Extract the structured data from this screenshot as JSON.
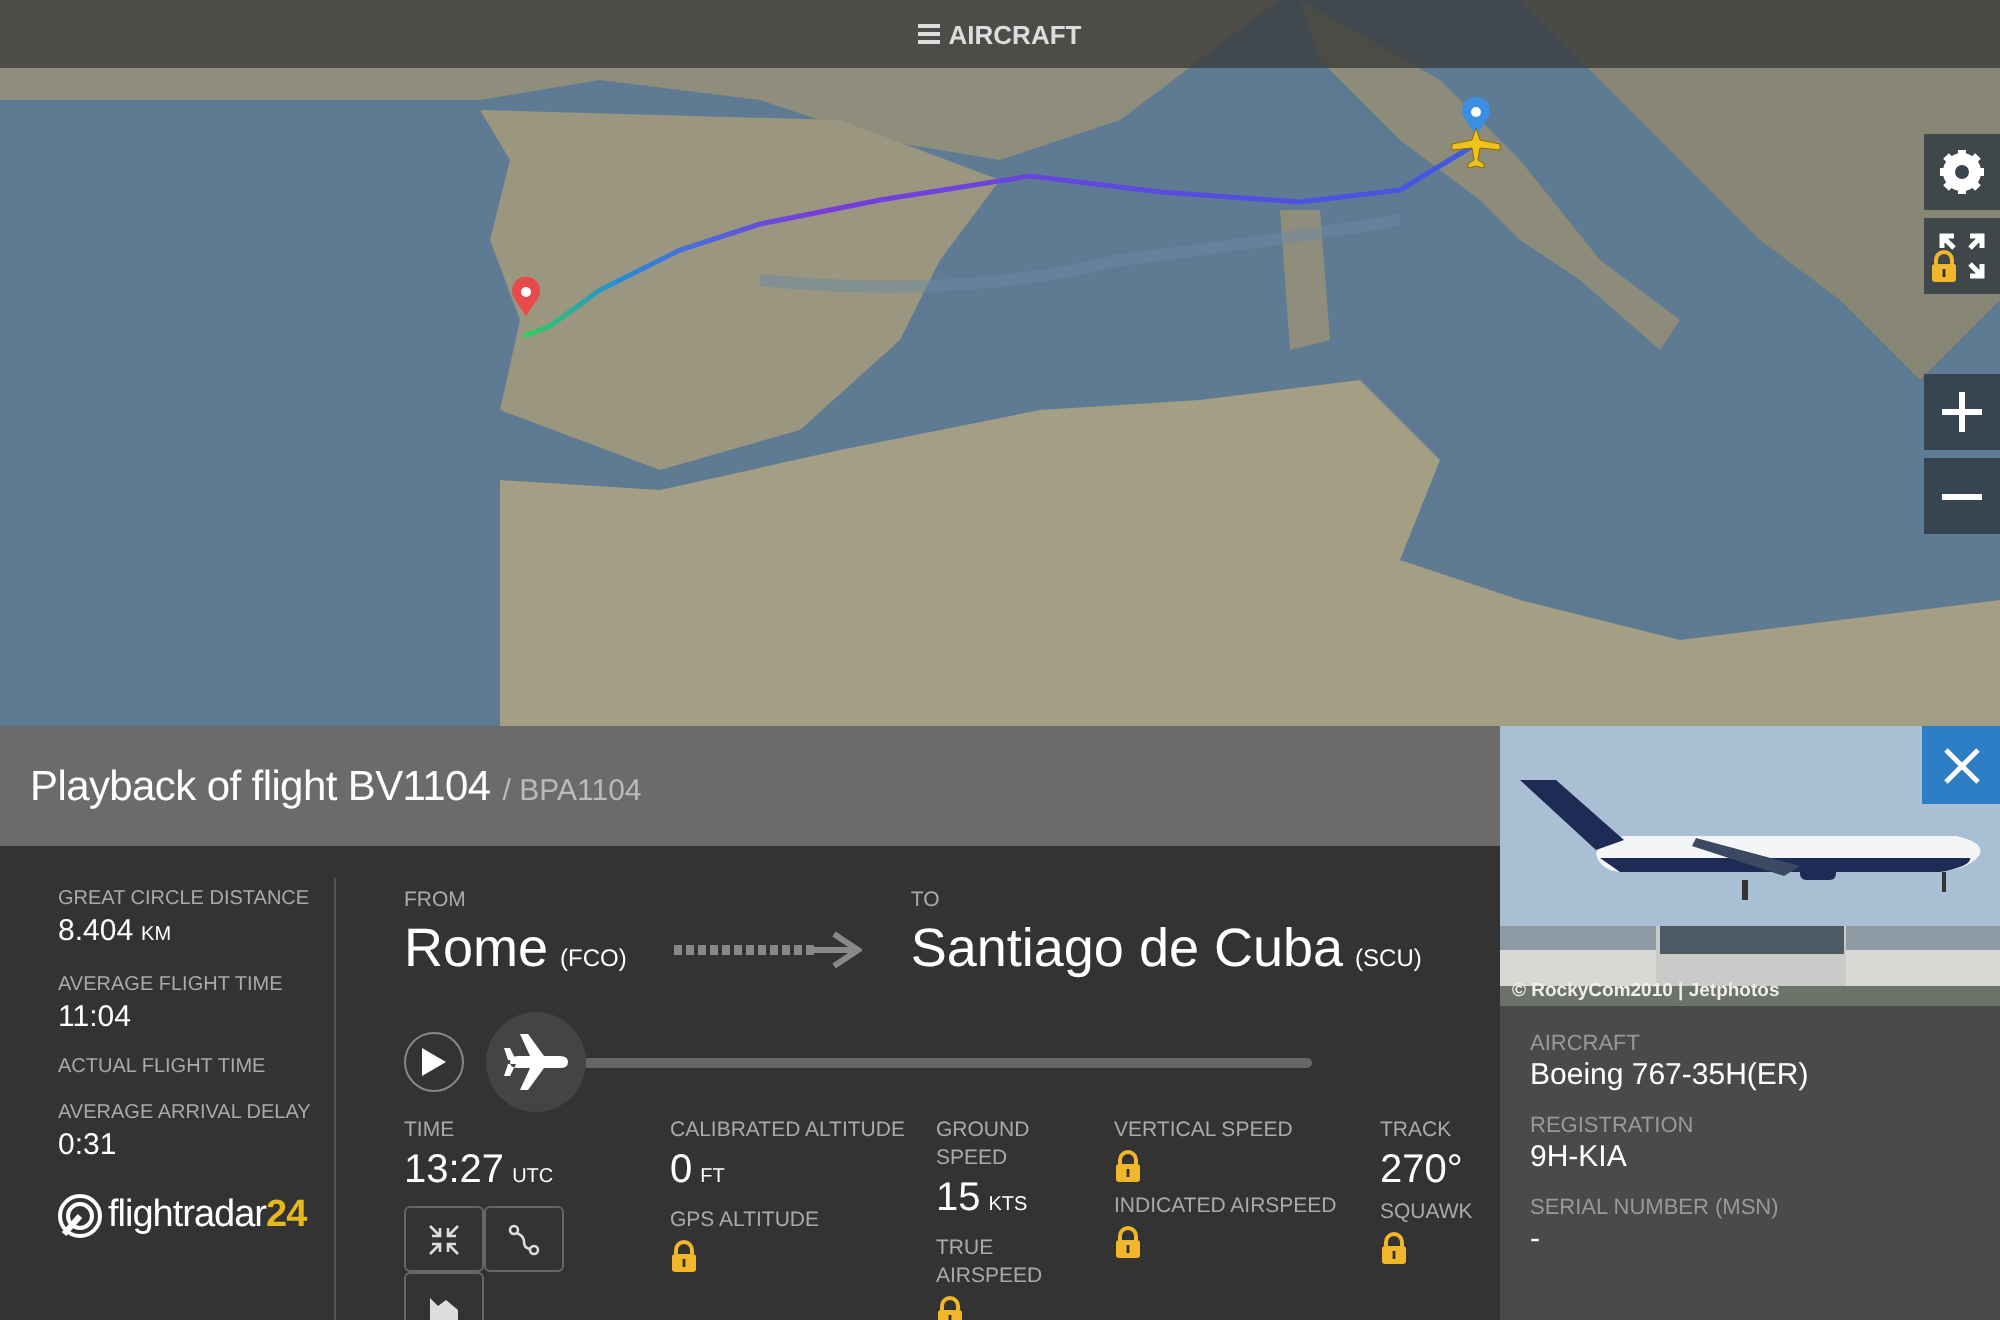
{
  "top_bar": {
    "label": "AIRCRAFT"
  },
  "map_controls": [
    {
      "kind": "settings",
      "locked": false
    },
    {
      "kind": "fullscreen",
      "locked": true
    },
    {
      "kind": "zoom_in",
      "locked": false
    },
    {
      "kind": "zoom_out",
      "locked": false
    }
  ],
  "flight": {
    "title": "Playback of flight BV1104",
    "callsign": "/ BPA1104"
  },
  "stats": [
    {
      "label": "GREAT CIRCLE DISTANCE",
      "value": "8.404",
      "unit": "KM"
    },
    {
      "label": "AVERAGE FLIGHT TIME",
      "value": "11:04"
    },
    {
      "label": "ACTUAL FLIGHT TIME"
    },
    {
      "label": "AVERAGE ARRIVAL DELAY",
      "value": "0:31"
    }
  ],
  "logo": {
    "name": "flightradar",
    "number": "24"
  },
  "route": {
    "from_label": "FROM",
    "from_city": "Rome",
    "from_code": "(FCO)",
    "to_label": "TO",
    "to_city": "Santiago de Cuba",
    "to_code": "(SCU)"
  },
  "playback": {
    "playing": false,
    "level": 0
  },
  "data_columns": [
    [
      {
        "label": "TIME",
        "value": "13:27",
        "unit": "UTC"
      }
    ],
    [
      {
        "label": "CALIBRATED ALTITUDE",
        "value": "0",
        "unit": "FT"
      },
      {
        "label": "GPS ALTITUDE",
        "locked": true
      }
    ],
    [
      {
        "label": "GROUND SPEED",
        "value": "15",
        "unit": "KTS"
      },
      {
        "label": "TRUE AIRSPEED",
        "locked": true
      }
    ],
    [
      {
        "label": "VERTICAL SPEED",
        "locked": true
      },
      {
        "label": "INDICATED AIRSPEED",
        "locked": true
      }
    ],
    [
      {
        "label": "TRACK",
        "value": "270°"
      },
      {
        "label": "SQUAWK",
        "locked": true
      }
    ]
  ],
  "view_buttons": [
    {
      "kind": "collapse"
    },
    {
      "kind": "route"
    },
    {
      "kind": "chart"
    }
  ],
  "aircraft": {
    "photo_credit": "© RockyCom2010 | Jetphotos",
    "fields": [
      {
        "label": "AIRCRAFT",
        "value": "Boeing 767-35H(ER)"
      },
      {
        "label": "REGISTRATION",
        "value": "9H-KIA"
      },
      {
        "label": "SERIAL NUMBER (MSN)",
        "value": "-"
      }
    ]
  }
}
